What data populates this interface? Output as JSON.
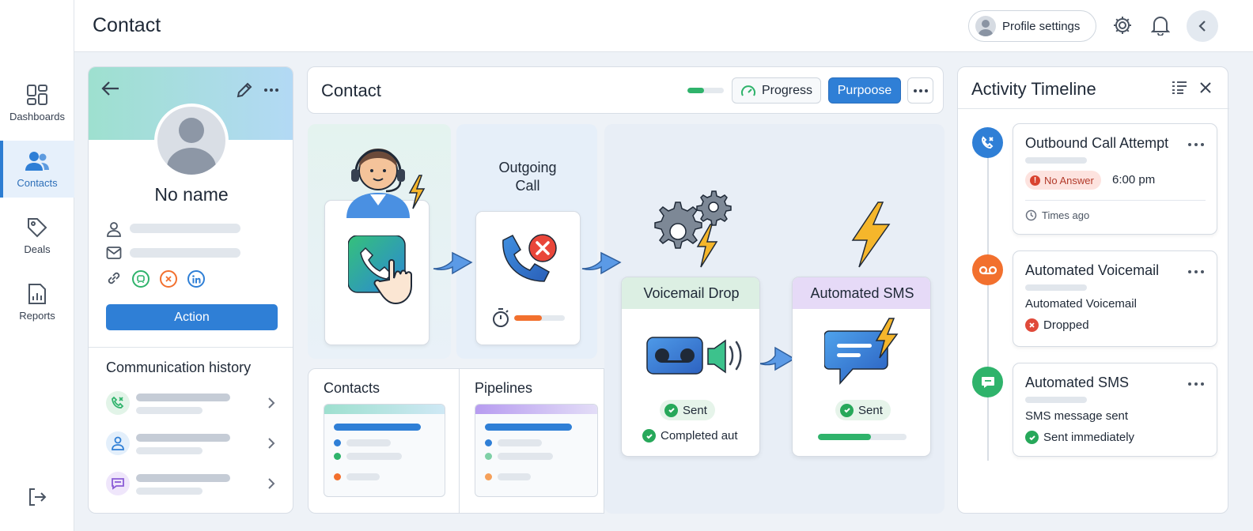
{
  "nav": {
    "items": [
      {
        "label": "Dashboards"
      },
      {
        "label": "Contacts"
      },
      {
        "label": "Deals"
      },
      {
        "label": "Reports"
      }
    ]
  },
  "header": {
    "title": "Contact",
    "profile_label": "Profile settings"
  },
  "profile": {
    "name": "No name",
    "action_label": "Action",
    "comm_title": "Communication history"
  },
  "contact_panel": {
    "title": "Contact",
    "progress_label": "Progress",
    "progress_value": 0.45,
    "purpose_label": "Purpoose"
  },
  "flow": {
    "outgoing_label": "Outgoing\nCall",
    "call_timer_progress": 0.55,
    "voicemail": {
      "title": "Voicemail Drop",
      "status": "Sent",
      "note": "Completed aut"
    },
    "sms": {
      "title": "Automated SMS",
      "status": "Sent",
      "progress": 0.6
    }
  },
  "panels": {
    "contacts_title": "Contacts",
    "pipelines_title": "Pipelines"
  },
  "timeline": {
    "title": "Activity Timeline",
    "events": [
      {
        "title": "Outbound Call Attempt",
        "badge": "No Answer",
        "time": "6:00 pm",
        "footnote": "Times ago"
      },
      {
        "title": "Automated Voicemail",
        "subtitle": "Automated Voicemail",
        "status": "Dropped"
      },
      {
        "title": "Automated SMS",
        "subtitle": "SMS message sent",
        "status": "Sent immediately"
      }
    ]
  },
  "colors": {
    "accent": "#2f7fd6",
    "success": "#27a85a",
    "danger": "#e04a3a",
    "voicemail": "#f2702e",
    "sms": "#2fb36b"
  }
}
